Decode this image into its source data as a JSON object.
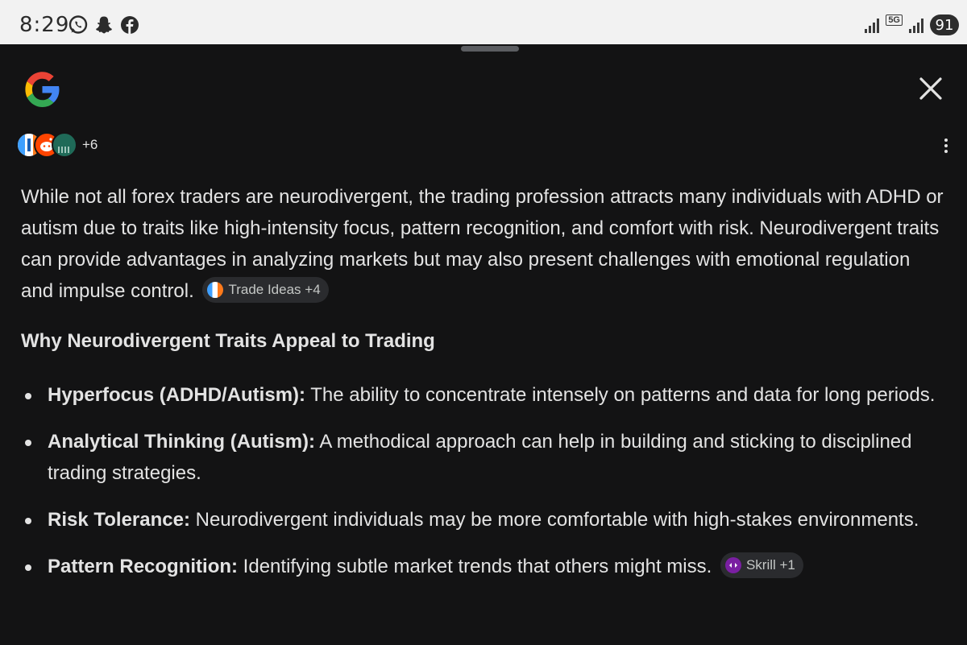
{
  "status_bar": {
    "time": "8:29",
    "network": "5G",
    "battery": "91"
  },
  "header": {
    "sources_more": "+6"
  },
  "summary": {
    "text": "While not all forex traders are neurodivergent, the trading profession attracts many individuals with ADHD or autism due to traits like high-intensity focus, pattern recognition, and comfort with risk. Neurodivergent traits can provide advantages in analyzing markets but may also present challenges with emotional regulation and impulse control.",
    "citation": "Trade Ideas +4"
  },
  "section": {
    "heading": "Why Neurodivergent Traits Appeal to Trading",
    "items": [
      {
        "term": "Hyperfocus (ADHD/Autism):",
        "text": " The ability to concentrate intensely on patterns and data for long periods."
      },
      {
        "term": "Analytical Thinking (Autism):",
        "text": " A methodical approach can help in building and sticking to disciplined trading strategies."
      },
      {
        "term": "Risk Tolerance:",
        "text": " Neurodivergent individuals may be more comfortable with high-stakes environments."
      },
      {
        "term": "Pattern Recognition:",
        "text": " Identifying subtle market trends that others might miss. "
      }
    ],
    "last_citation": "Skrill +1"
  },
  "icons": {
    "left_status": [
      "whatsapp-icon",
      "snapchat-icon",
      "facebook-icon"
    ],
    "right_status": [
      "signal-icon",
      "5g-icon",
      "signal-icon",
      "battery-icon"
    ],
    "header": [
      "google-logo",
      "close-icon",
      "more-vert-icon"
    ]
  },
  "colors": {
    "background": "#131314",
    "text": "#e3e3e3",
    "chip_bg": "#2a2b2e",
    "status_bar": "#f2f2f2"
  }
}
